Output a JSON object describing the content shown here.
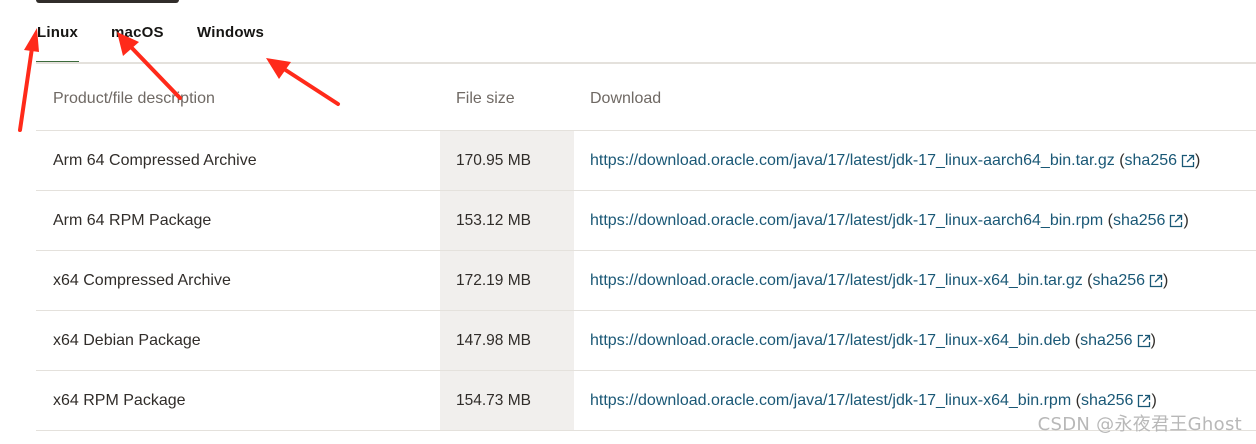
{
  "tabs": [
    {
      "label": "Linux",
      "active": true
    },
    {
      "label": "macOS",
      "active": false
    },
    {
      "label": "Windows",
      "active": false
    }
  ],
  "table": {
    "headers": {
      "description": "Product/file description",
      "size": "File size",
      "download": "Download"
    },
    "rows": [
      {
        "description": "Arm 64 Compressed Archive",
        "size": "170.95 MB",
        "url": "https://download.oracle.com/java/17/latest/jdk-17_linux-aarch64_bin.tar.gz",
        "sha_prefix": " (",
        "sha": "sha256",
        "sha_suffix": ")"
      },
      {
        "description": "Arm 64 RPM Package",
        "size": "153.12 MB",
        "url": "https://download.oracle.com/java/17/latest/jdk-17_linux-aarch64_bin.rpm",
        "sha_prefix": " (",
        "sha": "sha256",
        "sha_suffix": ")"
      },
      {
        "description": "x64 Compressed Archive",
        "size": "172.19 MB",
        "url": "https://download.oracle.com/java/17/latest/jdk-17_linux-x64_bin.tar.gz",
        "sha_prefix": " (",
        "sha": "sha256",
        "sha_suffix": ")"
      },
      {
        "description": "x64 Debian Package",
        "size": "147.98 MB",
        "url": "https://download.oracle.com/java/17/latest/jdk-17_linux-x64_bin.deb",
        "sha_prefix": " (",
        "sha": "sha256",
        "sha_suffix": ")"
      },
      {
        "description": "x64 RPM Package",
        "size": "154.73 MB",
        "url": "https://download.oracle.com/java/17/latest/jdk-17_linux-x64_bin.rpm",
        "sha_prefix": " (",
        "sha": "sha256",
        "sha_suffix": ")"
      }
    ]
  },
  "watermark": "CSDN @永夜君王Ghost",
  "colors": {
    "link": "#1a5876",
    "active_tab_underline": "#3c6b3c",
    "annotation_arrow": "#ff2a1a",
    "size_column_bg": "#f1efed"
  },
  "icons": {
    "external_link": "external-link-icon",
    "annotation": "red-arrow-icon"
  }
}
